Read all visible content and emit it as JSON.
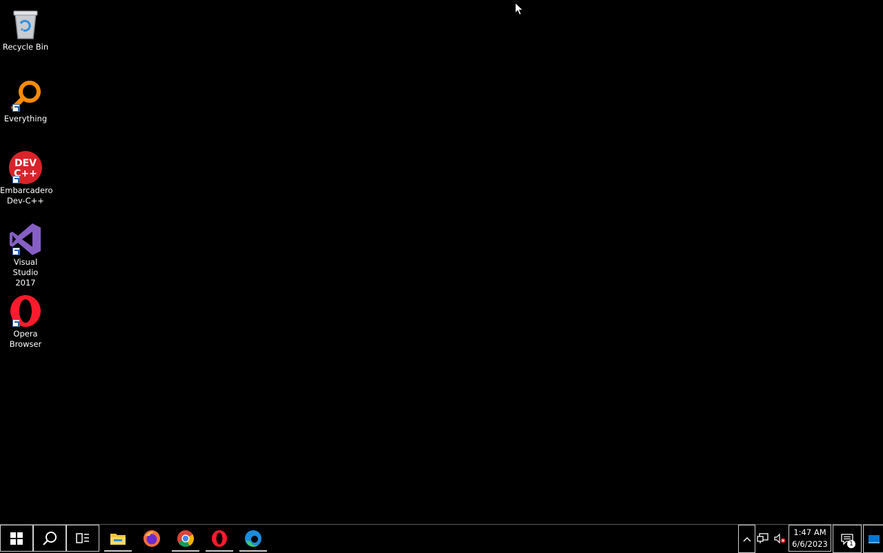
{
  "desktop": {
    "icons": [
      {
        "label": "Recycle Bin",
        "icon": "recycle-bin-icon",
        "shortcut": false
      },
      {
        "label": "Everything",
        "icon": "everything-search-icon",
        "shortcut": true
      },
      {
        "label": "Embarcadero\nDev-C++",
        "icon": "dev-cpp-icon",
        "icon_text": "DEV\nC++",
        "shortcut": true
      },
      {
        "label": "Visual Studio\n2017",
        "icon": "visual-studio-icon",
        "shortcut": true
      },
      {
        "label": "Opera\nBrowser",
        "icon": "opera-icon",
        "shortcut": true
      }
    ]
  },
  "taskbar": {
    "start": {
      "icon": "windows-start-icon"
    },
    "search": {
      "icon": "search-icon"
    },
    "task_view": {
      "icon": "task-view-icon"
    },
    "pinned_apps": [
      {
        "name": "File Explorer",
        "icon": "file-explorer-icon",
        "running": true
      },
      {
        "name": "Firefox",
        "icon": "firefox-icon",
        "running": false
      },
      {
        "name": "Google Chrome",
        "icon": "chrome-icon",
        "running": true
      },
      {
        "name": "Opera",
        "icon": "opera-icon",
        "running": true
      },
      {
        "name": "Microsoft Edge",
        "icon": "edge-icon",
        "running": true
      }
    ],
    "tray": {
      "icons": [
        "chevron-up-icon",
        "network-icon",
        "speaker-muted-icon"
      ],
      "time": "1:47 AM",
      "date": "6/6/2023",
      "notification_count": "1"
    }
  },
  "colors": {
    "desktop_background": "#000000",
    "taskbar_background": "#000000",
    "accent": "#0078d7"
  }
}
